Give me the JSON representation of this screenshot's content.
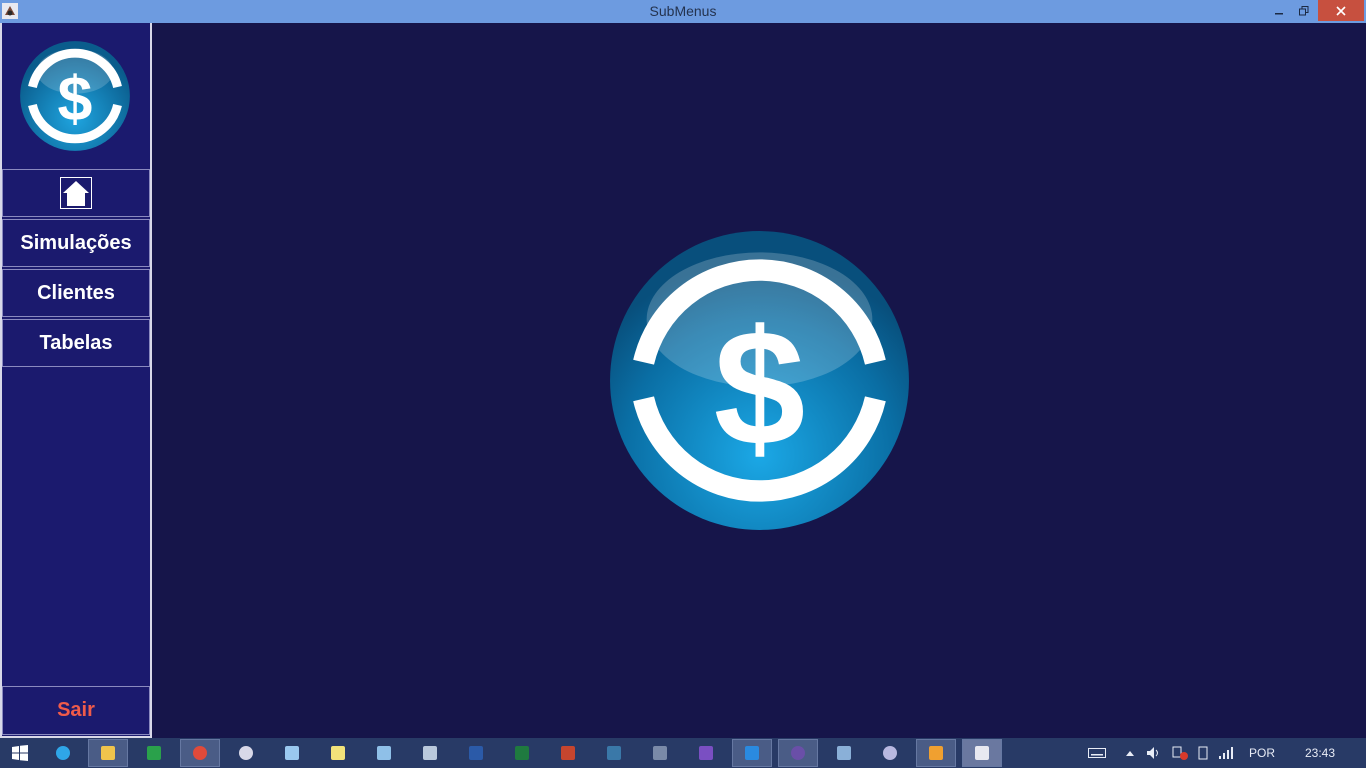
{
  "window": {
    "title": "SubMenus"
  },
  "sidebar": {
    "items": [
      {
        "label": "Simulações"
      },
      {
        "label": "Clientes"
      },
      {
        "label": "Tabelas"
      }
    ],
    "exit_label": "Sair",
    "home_icon": "home-icon"
  },
  "colors": {
    "titlebar": "#6d9be0",
    "sidebar": "#1b1a6e",
    "main_bg": "#16154a",
    "exit_text": "#ef5b4a",
    "close_button": "#c7503f",
    "logo_blue": "#0a7fb8"
  },
  "taskbar": {
    "apps": [
      "start-icon",
      "internet-explorer-icon",
      "file-explorer-icon",
      "store-icon",
      "chrome-icon",
      "paint-icon",
      "notepad-icon",
      "sticky-notes-icon",
      "remote-desktop-icon",
      "calculator-icon",
      "word-icon",
      "excel-icon",
      "powerpoint-icon",
      "mysql-workbench-icon",
      "sql-server-icon",
      "visual-studio-icon",
      "vscode-icon",
      "github-icon",
      "virtualbox-icon",
      "database-icon",
      "media-player-icon",
      "java-app-icon"
    ],
    "language": "POR",
    "time": "23:43"
  }
}
